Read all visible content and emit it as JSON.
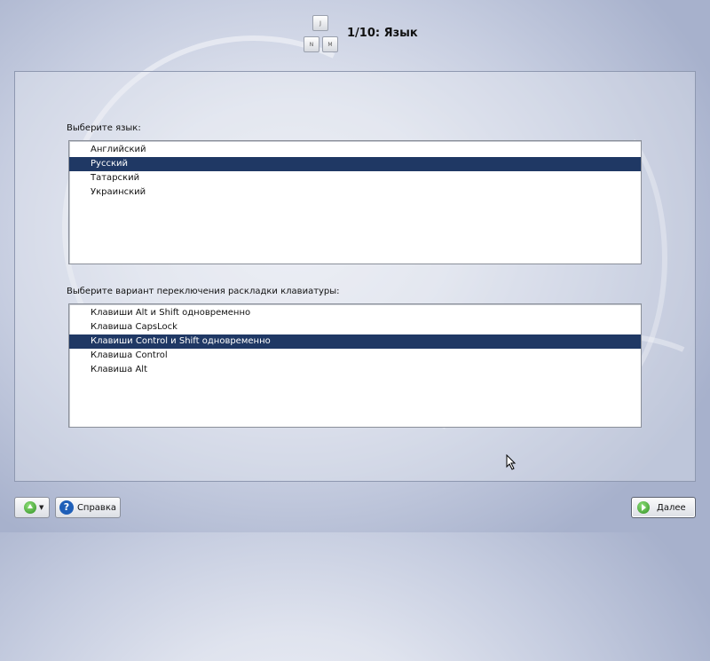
{
  "header": {
    "keys": [
      "J",
      "N",
      "M"
    ],
    "title": "1/10: Язык"
  },
  "language": {
    "label": "Выберите язык:",
    "items": [
      "Английский",
      "Русский",
      "Татарский",
      "Украинский"
    ],
    "selected": "Русский"
  },
  "layout_switch": {
    "label": "Выберите вариант переключения раскладки клавиатуры:",
    "items": [
      "Клавиши Alt и Shift одновременно",
      "Клавиша CapsLock",
      "Клавиши Control и Shift одновременно",
      "Клавиша Control",
      "Клавиша Alt"
    ],
    "selected": "Клавиши Control и Shift одновременно"
  },
  "buttons": {
    "help": "Справка",
    "next": "Далее"
  },
  "icons": {
    "menu": "green-up-arrow-icon",
    "help": "help-icon",
    "next": "green-right-arrow-icon"
  }
}
